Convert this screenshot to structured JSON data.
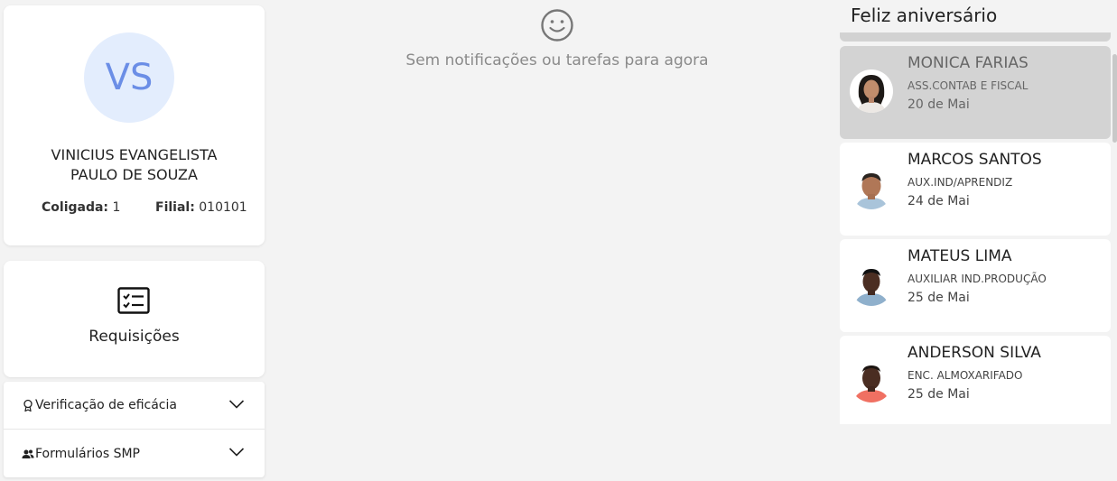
{
  "profile": {
    "initials": "VS",
    "name": "VINICIUS EVANGELISTA PAULO DE SOUZA",
    "coligada_label": "Coligada:",
    "coligada_value": "1",
    "filial_label": "Filial:",
    "filial_value": "010101",
    "avatar_color": "#e3edfd",
    "initials_color": "#6b8ee6"
  },
  "requisicoes": {
    "label": "Requisições",
    "icon": "checklist-icon"
  },
  "accordion": {
    "items": [
      {
        "label": "Verificação de eficácia",
        "icon": "award-icon"
      },
      {
        "label": "Formulários SMP",
        "icon": "users-icon"
      }
    ]
  },
  "notifications": {
    "icon": "smile-icon",
    "empty_message": "Sem notificações ou tarefas para agora"
  },
  "birthdays": {
    "title": "Feliz aniversário",
    "items": [
      {
        "name": "MONICA FARIAS",
        "role": "ASS.CONTAB E FISCAL",
        "date": "20 de Mai"
      },
      {
        "name": "MARCOS SANTOS",
        "role": "AUX.IND/APRENDIZ",
        "date": "24 de Mai"
      },
      {
        "name": "MATEUS LIMA",
        "role": "AUXILIAR IND.PRODUÇÃO",
        "date": "25 de Mai"
      },
      {
        "name": "ANDERSON SILVA",
        "role": "ENC. ALMOXARIFADO",
        "date": "25 de Mai"
      }
    ]
  }
}
